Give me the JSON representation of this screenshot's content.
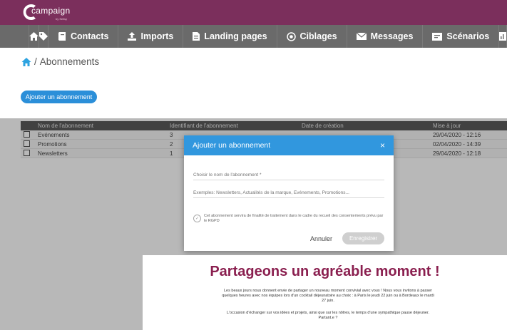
{
  "app": {
    "logo_text": "campaign",
    "logo_sub": "by Sellsy"
  },
  "nav": {
    "items": [
      {
        "label": "",
        "icon": "home-icon"
      },
      {
        "label": "",
        "icon": "tag-icon"
      },
      {
        "label": "Contacts",
        "icon": "contacts-book-icon"
      },
      {
        "label": "Imports",
        "icon": "upload-icon"
      },
      {
        "label": "Landing pages",
        "icon": "page-icon"
      },
      {
        "label": "Ciblages",
        "icon": "target-icon"
      },
      {
        "label": "Messages",
        "icon": "envelope-icon"
      },
      {
        "label": "Scénarios",
        "icon": "scenario-icon"
      }
    ]
  },
  "breadcrumb": {
    "sep": "/",
    "current": "Abonnements"
  },
  "add_button": "Ajouter un abonnement",
  "table": {
    "headers": [
      "Nom de l'abonnement",
      "Identifiant de l'abonnement",
      "Date de création",
      "Mise à jour"
    ],
    "rows": [
      {
        "name": "Evénements",
        "id": "3",
        "created": "",
        "updated": "29/04/2020 - 12:16"
      },
      {
        "name": "Promotions",
        "id": "2",
        "created": "",
        "updated": "02/04/2020 - 14:39"
      },
      {
        "name": "Newsletters",
        "id": "1",
        "created": "",
        "updated": "29/04/2020 - 12:18"
      }
    ]
  },
  "modal": {
    "title": "Ajouter un abonnement",
    "close": "×",
    "name_placeholder": "Choisir le nom de l'abonnement *",
    "examples_placeholder": "Exemples: Newsletters, Actualités de la marque, Evénements, Promotions...",
    "consent_text": "Cet abonnement servira de finalité de traitement dans le cadre du recueil des consentements prévu par le RGPD",
    "cancel": "Annuler",
    "save": "Enregistrer"
  },
  "preview": {
    "title": "Partageons un agréable moment !",
    "p1": "Les beaux jours nous donnent envie de partager un nouveau moment convivial avec vous ! Nous vous invitons à passer quelques heures avec nos équipes lors d'un cocktail déjeunatoire au choix : à Paris le jeudi 22 juin ou à Bordeaux le mardi 27 juin.",
    "p2": "L'occasion d'échanger sur vos idées et projets, ainsi que sur les nôtres, le temps d'une sympathique pause déjeuner. Partant.e ?"
  },
  "colors": {
    "brand": "#7b2f5c",
    "nav_bg": "#6a6a6a",
    "accent": "#2b8fd9",
    "modal_header": "#3197de",
    "preview_title": "#8a1f4f"
  }
}
